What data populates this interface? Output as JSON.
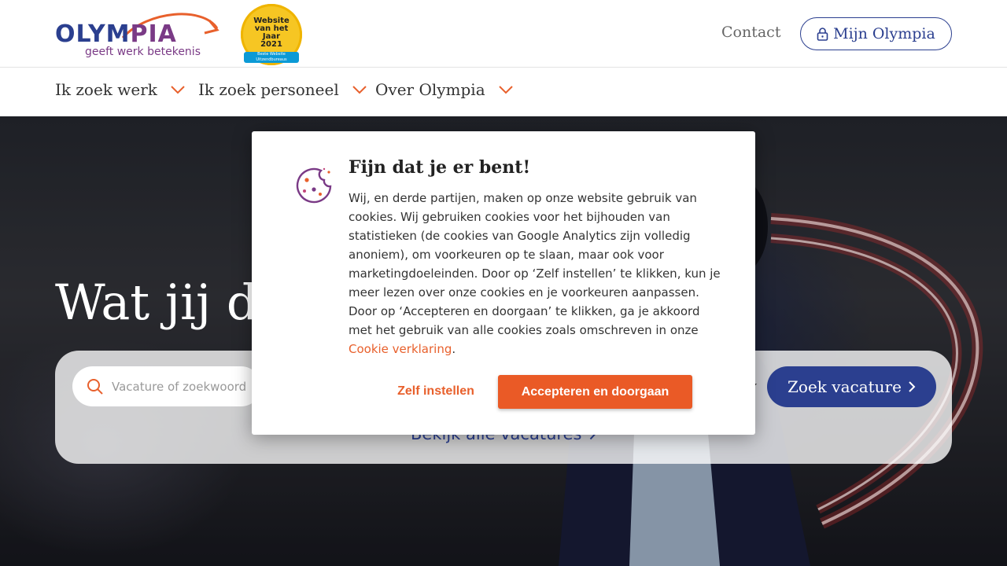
{
  "header": {
    "logo_text_main": "OLYM",
    "logo_text_accent": "PIA",
    "logo_tagline": "geeft werk betekenis",
    "award_text": "Website\nvan het\nJaar\n2021",
    "award_ribbon": "Beste Website\nUitzendbureaus",
    "contact_label": "Contact",
    "mijn_label": "Mijn Olympia"
  },
  "nav": {
    "items": [
      {
        "label": "Ik zoek werk"
      },
      {
        "label": "Ik zoek personeel"
      },
      {
        "label": "Over Olympia"
      }
    ]
  },
  "hero": {
    "title": "Wat jij do",
    "search_placeholder": "Vacature of zoekwoord",
    "search_button": "Zoek vacature",
    "all_vacancies_link": "Bekijk alle vacatures"
  },
  "cookie_modal": {
    "title": "Fijn dat je er bent!",
    "body": "Wij, en derde partijen, maken op onze website gebruik van cookies. Wij gebruiken cookies voor het bijhouden van statistieken (de cookies van Google Analytics zijn volledig anoniem), om voorkeuren op te slaan, maar ook voor marketingdoeleinden. Door op ‘Zelf instellen’ te klikken, kun je meer lezen over onze cookies en je voorkeuren aanpassen. Door op ‘Accepteren en doorgaan’ te klikken, ga je akkoord met het gebruik van alle cookies zoals omschreven in onze ",
    "link_label": "Cookie verklaring",
    "body_end": ".",
    "settings_button": "Zelf instellen",
    "accept_button": "Accepteren en doorgaan"
  },
  "colors": {
    "brand_blue": "#2b3f8f",
    "brand_purple": "#7a3a86",
    "accent_orange": "#ea5a26"
  },
  "icons": [
    "lock-icon",
    "chevron-down-icon",
    "search-icon",
    "chevron-right-icon",
    "cookie-icon"
  ]
}
